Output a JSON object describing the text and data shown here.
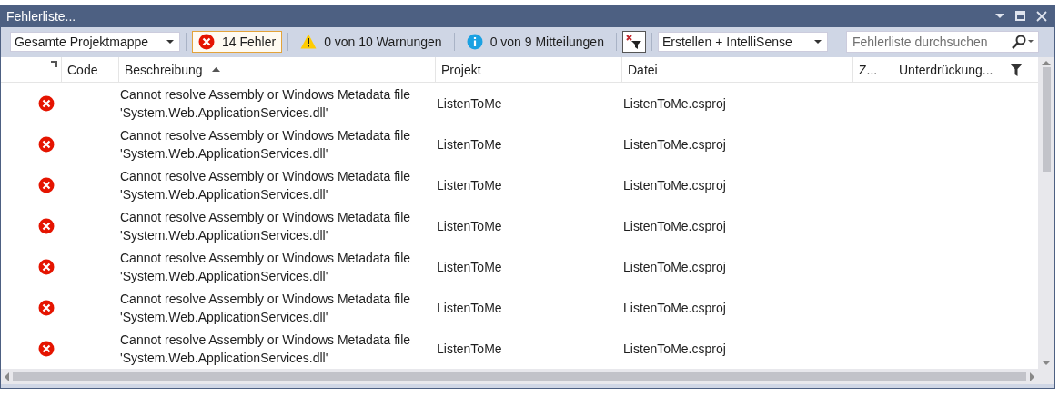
{
  "window": {
    "title": "Fehlerliste..."
  },
  "toolbar": {
    "scope": "Gesamte Projektmappe",
    "filters": [
      {
        "kind": "error",
        "label": "14 Fehler",
        "selected": true
      },
      {
        "kind": "warning",
        "label": "0 von 10 Warnungen",
        "selected": false
      },
      {
        "kind": "info",
        "label": "0 von 9 Mitteilungen",
        "selected": false
      }
    ],
    "source": "Erstellen + IntelliSense",
    "search": {
      "placeholder": "Fehlerliste durchsuchen"
    }
  },
  "table": {
    "columns": [
      {
        "label": "Code",
        "sorted": false
      },
      {
        "label": "Beschreibung",
        "sorted": true
      },
      {
        "label": "Projekt",
        "sorted": false
      },
      {
        "label": "Datei",
        "sorted": false
      },
      {
        "label": "Z...",
        "sorted": false
      },
      {
        "label": "Unterdrückung...",
        "sorted": false
      }
    ],
    "rows": [
      {
        "kind": "error",
        "description": "Cannot resolve Assembly or Windows Metadata file\n'System.Web.ApplicationServices.dll'",
        "project": "ListenToMe",
        "file": "ListenToMe.csproj"
      },
      {
        "kind": "error",
        "description": "Cannot resolve Assembly or Windows Metadata file\n'System.Web.ApplicationServices.dll'",
        "project": "ListenToMe",
        "file": "ListenToMe.csproj"
      },
      {
        "kind": "error",
        "description": "Cannot resolve Assembly or Windows Metadata file\n'System.Web.ApplicationServices.dll'",
        "project": "ListenToMe",
        "file": "ListenToMe.csproj"
      },
      {
        "kind": "error",
        "description": "Cannot resolve Assembly or Windows Metadata file\n'System.Web.ApplicationServices.dll'",
        "project": "ListenToMe",
        "file": "ListenToMe.csproj"
      },
      {
        "kind": "error",
        "description": "Cannot resolve Assembly or Windows Metadata file\n'System.Web.ApplicationServices.dll'",
        "project": "ListenToMe",
        "file": "ListenToMe.csproj"
      },
      {
        "kind": "error",
        "description": "Cannot resolve Assembly or Windows Metadata file\n'System.Web.ApplicationServices.dll'",
        "project": "ListenToMe",
        "file": "ListenToMe.csproj"
      },
      {
        "kind": "error",
        "description": "Cannot resolve Assembly or Windows Metadata file\n'System.Web.ApplicationServices.dll'",
        "project": "ListenToMe",
        "file": "ListenToMe.csproj"
      }
    ]
  }
}
